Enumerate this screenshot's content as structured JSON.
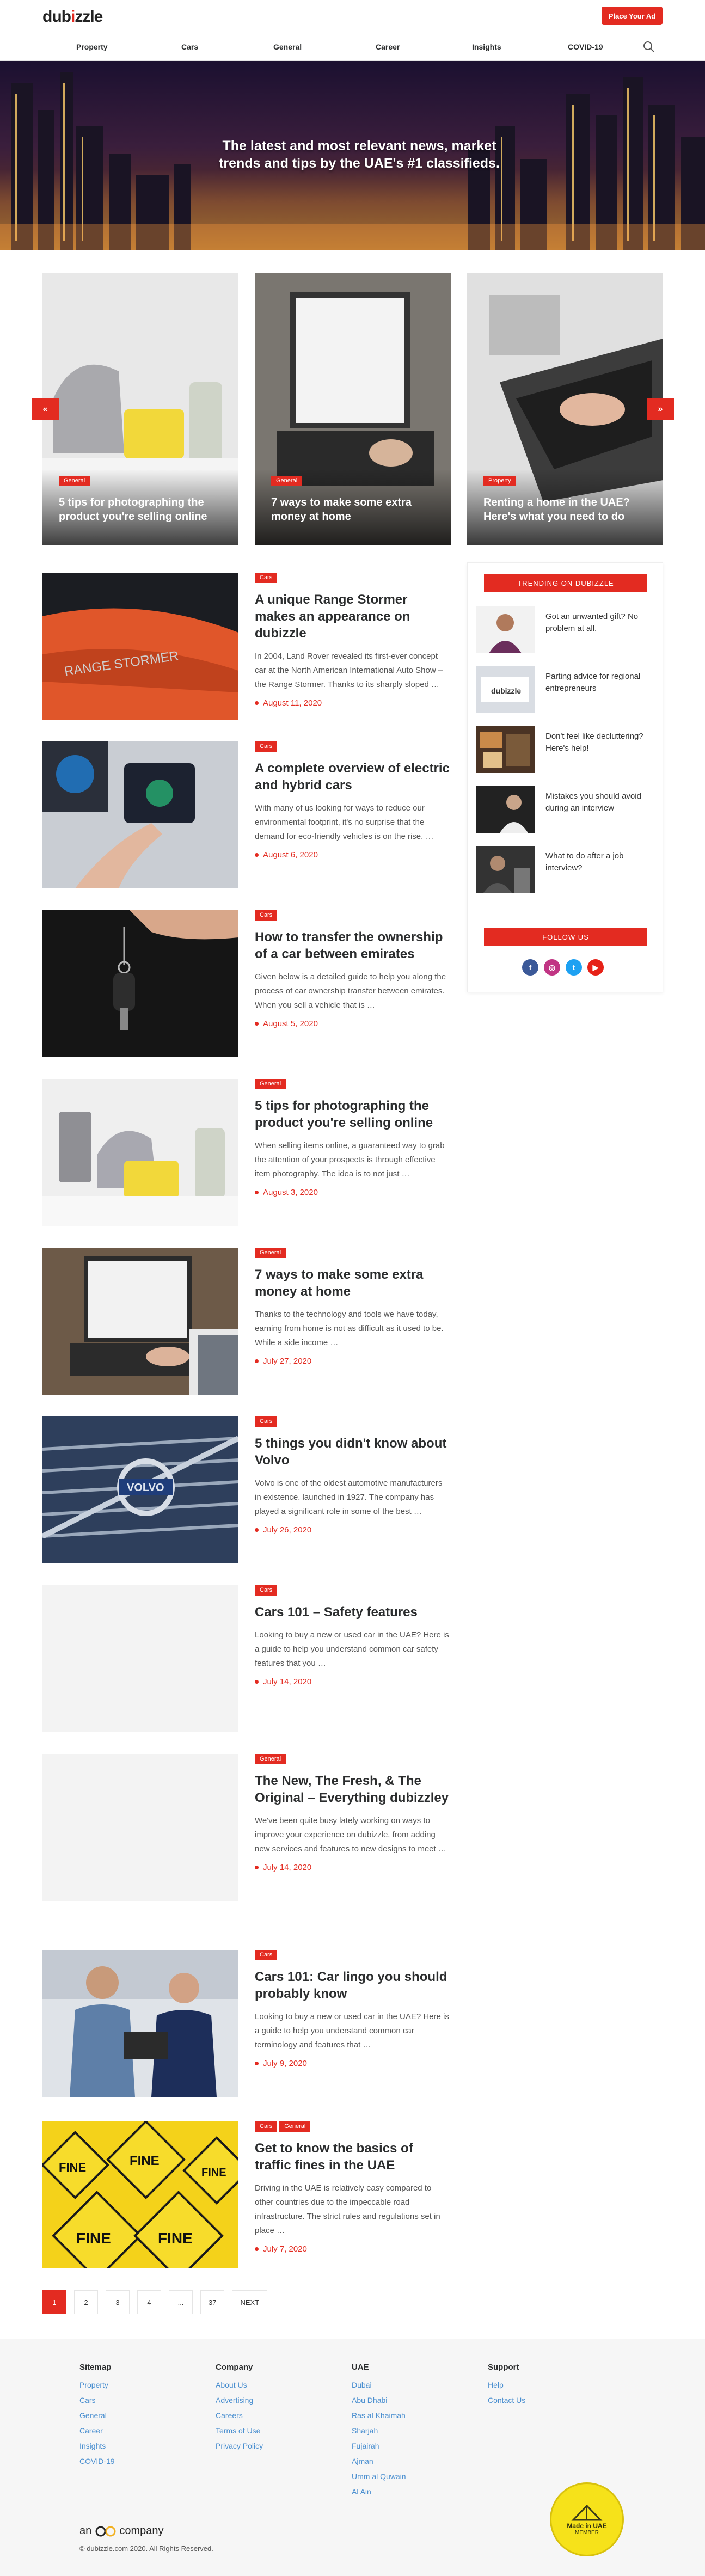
{
  "header": {
    "logo_main": "dub",
    "logo_dot": "i",
    "logo_rest": "zzle",
    "place_ad": "Place Your Ad"
  },
  "nav": [
    "Property",
    "Cars",
    "General",
    "Career",
    "Insights",
    "COVID-19"
  ],
  "hero": {
    "title": "The latest and most relevant news, market trends and tips by the UAE's #1 classifieds."
  },
  "slider": {
    "prev": "«",
    "next": "»",
    "slides": [
      {
        "badge": "General",
        "title": "5 tips for photographing the product you're selling online"
      },
      {
        "badge": "General",
        "title": "7 ways to make some extra money at home"
      },
      {
        "badge": "Property",
        "title": "Renting a home in the UAE? Here's what you need to do"
      }
    ]
  },
  "articles": [
    {
      "badges": [
        "Cars"
      ],
      "title": "A unique Range Stormer makes an appearance on dubizzle",
      "excerpt": "In 2004, Land Rover revealed its first-ever concept car at the North American International Auto Show – the Range Stormer. Thanks to its sharply sloped …",
      "date": "August 11, 2020",
      "image": "orange-range-stormer"
    },
    {
      "badges": [
        "Cars"
      ],
      "title": "A complete overview of electric and hybrid cars",
      "excerpt": "With many of us looking for ways to reduce our environmental footprint, it's no surprise that the demand for eco-friendly vehicles is on the rise. …",
      "date": "August 6, 2020",
      "image": "ev-dashboard"
    },
    {
      "badges": [
        "Cars"
      ],
      "title": "How to transfer the ownership of a car between emirates",
      "excerpt": "Given below is a detailed guide to help you along the process of car ownership transfer between emirates. When you sell a vehicle that is …",
      "date": "August 5, 2020",
      "image": "car-keys"
    },
    {
      "badges": [
        "General"
      ],
      "title": "5 tips for photographing the product you're selling online",
      "excerpt": "When selling items online, a guaranteed way to grab the attention of your prospects is through effective item photography.  The idea is to not just …",
      "date": "August 3, 2020",
      "image": "home-appliances"
    },
    {
      "badges": [
        "General"
      ],
      "title": "7 ways to make some extra money at home",
      "excerpt": "Thanks to the technology and tools we have today, earning from home is not as difficult as it used to be. While a side income …",
      "date": "July 27, 2020",
      "image": "laptop-typing"
    },
    {
      "badges": [
        "Cars"
      ],
      "title": "5 things you didn't know about Volvo",
      "excerpt": "Volvo is one of the oldest automotive manufacturers in existence. launched in 1927. The company has played a significant role in some of the best …",
      "date": "July 26, 2020",
      "image": "volvo-grille"
    },
    {
      "badges": [
        "Cars"
      ],
      "title": "Cars 101 – Safety features",
      "excerpt": "Looking to buy a new or used car in the UAE? Here is a guide to help you understand common car safety features that you …",
      "date": "July 14, 2020",
      "image": "blank"
    },
    {
      "badges": [
        "General"
      ],
      "title": "The New, The Fresh, & The Original – Everything dubizzley",
      "excerpt": "We've been quite busy lately working on ways to improve your experience on dubizzle, from adding new services and features to new designs to meet …",
      "date": "July 14, 2020",
      "image": "blank"
    },
    {
      "badges": [
        "Cars"
      ],
      "title": "Cars 101: Car lingo you should probably know",
      "excerpt": "Looking to buy a new or used car in the UAE? Here is a guide to help you understand common car terminology and features that …",
      "date": "July 9, 2020",
      "image": "mechanics"
    },
    {
      "badges": [
        "Cars",
        "General"
      ],
      "title": "Get to know the basics of traffic fines in the UAE",
      "excerpt": "Driving in the UAE is relatively easy compared to other countries due to the impeccable road infrastructure. The strict rules and regulations set in place …",
      "date": "July 7, 2020",
      "image": "fine-signs"
    }
  ],
  "sidebar": {
    "trending_title": "TRENDING ON DUBIZZLE",
    "trending": [
      "Got an unwanted gift? No problem at all.",
      "Parting advice for regional entrepreneurs",
      "Don't feel like decluttering? Here's help!",
      "Mistakes you should avoid during an interview",
      "What to do after a job interview?"
    ],
    "follow_title": "FOLLOW US",
    "social": [
      {
        "icon": "facebook-icon",
        "glyph": "f",
        "color": "#3b5998"
      },
      {
        "icon": "instagram-icon",
        "glyph": "◎",
        "color": "#c13584"
      },
      {
        "icon": "twitter-icon",
        "glyph": "t",
        "color": "#1da1f2"
      },
      {
        "icon": "youtube-icon",
        "glyph": "▶",
        "color": "#e62117"
      }
    ]
  },
  "pagination": [
    "1",
    "2",
    "3",
    "4",
    "...",
    "37",
    "NEXT"
  ],
  "footer": {
    "columns": [
      {
        "title": "Sitemap",
        "links": [
          "Property",
          "Cars",
          "General",
          "Career",
          "Insights",
          "COVID-19"
        ]
      },
      {
        "title": "Company",
        "links": [
          "About Us",
          "Advertising",
          "Careers",
          "Terms of Use",
          "Privacy Policy"
        ]
      },
      {
        "title": "UAE",
        "links": [
          "Dubai",
          "Abu Dhabi",
          "Ras al Khaimah",
          "Sharjah",
          "Fujairah",
          "Ajman",
          "Umm al Quwain",
          "Al Ain"
        ]
      },
      {
        "title": "Support",
        "links": [
          "Help",
          "Contact Us"
        ]
      }
    ],
    "company_prefix": "an",
    "company_suffix": "company",
    "copyright": "© dubizzle.com 2020. All Rights Reserved.",
    "seal_top": "Made in UAE",
    "seal_bottom": "MEMBER"
  }
}
